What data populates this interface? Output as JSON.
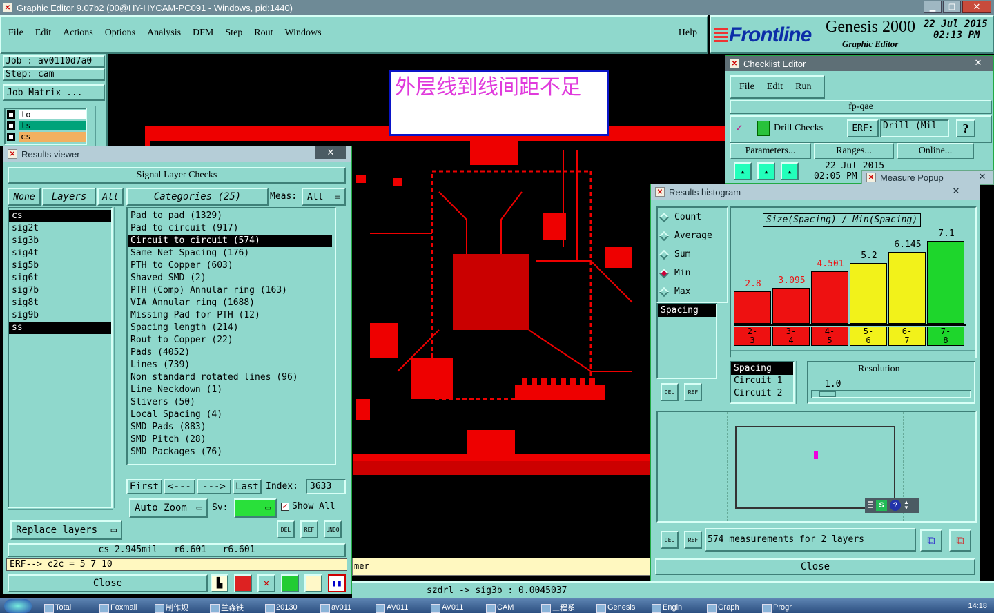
{
  "window": {
    "title": "Graphic Editor 9.07b2 (00@HY-HYCAM-PC091 - Windows, pid:1440)"
  },
  "menu": {
    "items": [
      "File",
      "Edit",
      "Actions",
      "Options",
      "Analysis",
      "DFM",
      "Step",
      "Rout",
      "Windows"
    ],
    "help": "Help"
  },
  "brand": {
    "logo": "Frontline",
    "product": "Genesis 2000",
    "subtitle": "Graphic Editor",
    "date": "22 Jul 2015",
    "time": "02:13 PM"
  },
  "job": {
    "job": "Job : av0110d7a0",
    "step": "Step: cam",
    "matrix_btn": "Job Matrix ...",
    "layers": [
      {
        "name": "to",
        "color": "#ffffff"
      },
      {
        "name": "ts",
        "color": "#00a37a"
      },
      {
        "name": "cs",
        "color": "#f2b060"
      }
    ]
  },
  "annotation": {
    "text": "外层线到线间距不足"
  },
  "results_viewer": {
    "title": "Results viewer",
    "header": "Signal Layer Checks",
    "none_btn": "None",
    "layers_btn": "Layers",
    "all_btn": "All",
    "layers": [
      "cs",
      "sig2t",
      "sig3b",
      "sig4t",
      "sig5b",
      "sig6t",
      "sig7b",
      "sig8t",
      "sig9b",
      "ss"
    ],
    "categories_btn": "Categories (25)",
    "meas_label": "Meas:",
    "meas_value": "All",
    "categories": [
      "Pad to pad (1329)",
      "Pad to circuit (917)",
      "Circuit to circuit (574)",
      "Same Net Spacing (176)",
      "PTH to Copper (603)",
      "Shaved SMD (2)",
      "PTH (Comp) Annular ring (163)",
      "VIA Annular ring (1688)",
      "Missing Pad for PTH (12)",
      "Spacing length (214)",
      "Rout to Copper (22)",
      "Pads (4052)",
      "Lines (739)",
      "Non standard rotated lines (96)",
      "Line Neckdown (1)",
      "Slivers (50)",
      "Local Spacing (4)",
      "SMD Pads (883)",
      "SMD Pitch (28)",
      "SMD Packages (76)"
    ],
    "first_btn": "First",
    "prev_btn": "<---",
    "next_btn": "--->",
    "last_btn": "Last",
    "index_label": "Index:",
    "index_value": "3633",
    "autozoom": "Auto Zoom",
    "sv_label": "Sv:",
    "showall": "Show All",
    "replace": "Replace layers",
    "del": "DEL",
    "ref": "REF",
    "undo": "UNDO",
    "status": "cs 2.945mil   r6.601   r6.601",
    "erf": "ERF--> c2c = 5 7 10",
    "close": "Close"
  },
  "checklist": {
    "title": "Checklist Editor",
    "menu": [
      "File",
      "Edit",
      "Run"
    ],
    "name": "fp-qae",
    "drill": "Drill Checks",
    "erf_label": "ERF:",
    "erf_value": "Drill (Mil",
    "q": "?",
    "params": "Parameters...",
    "ranges": "Ranges...",
    "online": "Online...",
    "date": "22 Jul 2015",
    "time": "02:05 PM"
  },
  "measure_popup": {
    "title": "Measure Popup"
  },
  "histogram": {
    "title": "Results histogram",
    "modes": [
      {
        "label": "Count",
        "on": false
      },
      {
        "label": "Average",
        "on": false
      },
      {
        "label": "Sum",
        "on": false
      },
      {
        "label": "Min",
        "on": true
      },
      {
        "label": "Max",
        "on": false
      }
    ],
    "list": [
      "Spacing"
    ],
    "chart_title": "Size(Spacing) / Min(Spacing)",
    "bars": [
      {
        "value": 2.8,
        "label": "2.8",
        "range": [
          "2-",
          "3"
        ],
        "color": "#ee1111"
      },
      {
        "value": 3.095,
        "label": "3.095",
        "range": [
          "3-",
          "4"
        ],
        "color": "#ee1111"
      },
      {
        "value": 4.501,
        "label": "4.501",
        "range": [
          "4-",
          "5"
        ],
        "color": "#ee1111"
      },
      {
        "value": 5.2,
        "label": "5.2",
        "range": [
          "5-",
          "6"
        ],
        "color": "#f2f21a"
      },
      {
        "value": 6.145,
        "label": "6.145",
        "range": [
          "6-",
          "7"
        ],
        "color": "#f2f21a"
      },
      {
        "value": 7.1,
        "label": "7.1",
        "range": [
          "7-",
          "8"
        ],
        "color": "#1ed62c"
      }
    ],
    "ymax": 7.1,
    "sublist": [
      "Spacing",
      "Circuit 1",
      "Circuit 2"
    ],
    "resolution_label": "Resolution",
    "resolution_value": "1.0",
    "summary": "574 measurements for 2 layers",
    "close": "Close",
    "del": "DEL",
    "ref": "REF"
  },
  "bottom_status": {
    "text": "szdrl -> sig3b : 0.0045037",
    "left": "mer"
  },
  "taskbar": {
    "items": [
      "Total",
      "Foxmail",
      "制作规",
      "兰森铁",
      "20130",
      "av011",
      "AV011",
      "AV011",
      "CAM",
      "工程系",
      "Genesis",
      "Engin",
      "Graph",
      "Progr"
    ],
    "clock": "14:18"
  }
}
